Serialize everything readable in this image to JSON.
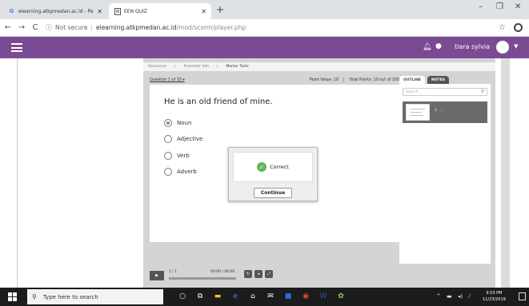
{
  "browser": {
    "tabs": [
      {
        "title": "elearning.atkpmedan.ac.id - Pers",
        "favicon": "G"
      },
      {
        "title": "EEN QUIZ",
        "favicon": "doc"
      }
    ],
    "url_info_label": "Not secure",
    "url_host": "elearning.atkpmedan.ac.id",
    "url_path": "/mod/scorm/player.php"
  },
  "moodle": {
    "user_name": "tiara sylvia",
    "brand_color": "#7a4a93"
  },
  "player": {
    "tabs": [
      "Resources",
      "Presenter Info",
      "Marker Tools"
    ],
    "question_nav": "Question 1 of 10 ▾",
    "point_value": "Point Value: 10",
    "total_points": "Total Points: 10 out of 100",
    "question": "He is an old friend of mine.",
    "options": [
      {
        "label": "Noun",
        "selected": true
      },
      {
        "label": "Adjective",
        "selected": false
      },
      {
        "label": "Verb",
        "selected": false
      },
      {
        "label": "Adverb",
        "selected": false
      }
    ],
    "feedback": {
      "text": "Correct",
      "button": "Continue"
    },
    "sidebar": {
      "tabs": [
        "OUTLINE",
        "NOTES"
      ],
      "search_placeholder": "Search...",
      "item_label": "1. ..."
    },
    "controls": {
      "slide_count": "1 / 1",
      "time": "00:00 / 00:00"
    }
  },
  "taskbar": {
    "search_placeholder": "Type here to search",
    "time": "9:53 PM",
    "date": "11/23/2019"
  }
}
